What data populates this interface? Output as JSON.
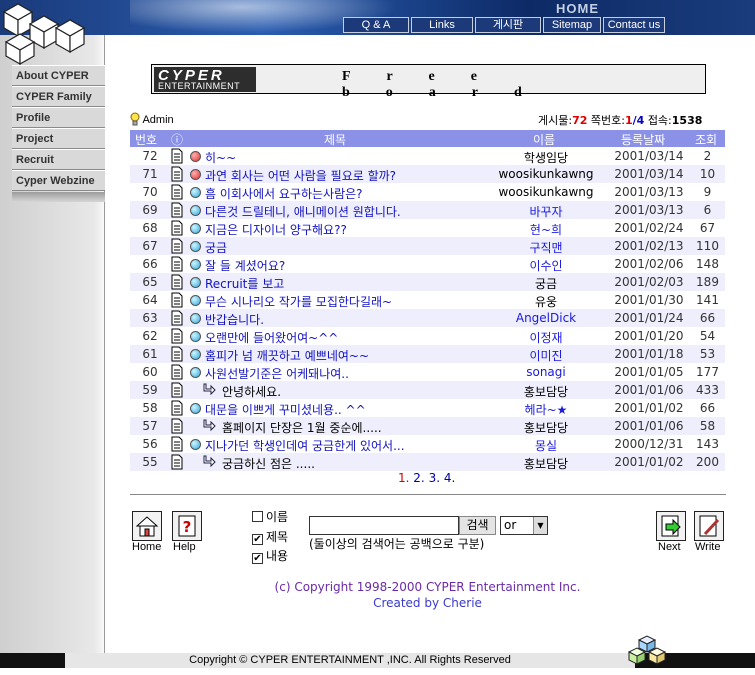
{
  "header": {
    "home_label": "HOME",
    "nav": [
      {
        "label": "Q & A"
      },
      {
        "label": "Links"
      },
      {
        "label": "게시판"
      },
      {
        "label": "Sitemap"
      },
      {
        "label": "Contact us"
      }
    ]
  },
  "sidebar": {
    "items": [
      {
        "label": "About CYPER"
      },
      {
        "label": "CYPER Family"
      },
      {
        "label": "Profile"
      },
      {
        "label": "Project"
      },
      {
        "label": "Recruit"
      },
      {
        "label": "Cyper Webzine"
      }
    ]
  },
  "board_title": {
    "logo_big": "CYPER",
    "logo_small": "ENTERTAINMENT",
    "title": "Free board"
  },
  "admin_label": "Admin",
  "stats": {
    "posts_label": "게시물:",
    "posts": "72",
    "page_label": "쪽번호:",
    "page_cur": "1",
    "page_sep": "/",
    "page_total": "4",
    "visits_label": "접속:",
    "visits": "1538"
  },
  "columns": {
    "num": "번호",
    "info_icon": "ⓘ",
    "title": "제목",
    "author": "이름",
    "date": "등록날짜",
    "hits": "조회"
  },
  "rows": [
    {
      "num": "72",
      "dot": "red",
      "reply": false,
      "title": "히~~",
      "author": "학생임당",
      "author_blue": false,
      "date": "2001/03/14",
      "hits": "2"
    },
    {
      "num": "71",
      "dot": "red",
      "reply": false,
      "title": "과연 회사는 어떤 사람을 필요로 할까?",
      "author": "woosikunkawng",
      "author_blue": false,
      "date": "2001/03/14",
      "hits": "10"
    },
    {
      "num": "70",
      "dot": "blue",
      "reply": false,
      "title": "흠 이회사에서 요구하는사람은?",
      "author": "woosikunkawng",
      "author_blue": false,
      "date": "2001/03/13",
      "hits": "9"
    },
    {
      "num": "69",
      "dot": "blue",
      "reply": false,
      "title": "다른것 드릴테니, 애니메이션 원합니다.",
      "author": "바꾸자",
      "author_blue": true,
      "date": "2001/03/13",
      "hits": "6"
    },
    {
      "num": "68",
      "dot": "blue",
      "reply": false,
      "title": "지금은 디자이너 양구해요??",
      "author": "현~희",
      "author_blue": true,
      "date": "2001/02/24",
      "hits": "67"
    },
    {
      "num": "67",
      "dot": "blue",
      "reply": false,
      "title": "궁금",
      "author": "구직맨",
      "author_blue": true,
      "date": "2001/02/13",
      "hits": "110"
    },
    {
      "num": "66",
      "dot": "blue",
      "reply": false,
      "title": "잘 들 계셨어요?",
      "author": "이수인",
      "author_blue": true,
      "date": "2001/02/06",
      "hits": "148"
    },
    {
      "num": "65",
      "dot": "blue",
      "reply": false,
      "title": "Recruit를 보고",
      "author": "궁금",
      "author_blue": false,
      "date": "2001/02/03",
      "hits": "189"
    },
    {
      "num": "64",
      "dot": "blue",
      "reply": false,
      "title": "무슨 시나리오 작가를 모집한다길래~",
      "author": "유웅",
      "author_blue": false,
      "date": "2001/01/30",
      "hits": "141"
    },
    {
      "num": "63",
      "dot": "blue",
      "reply": false,
      "title": "반갑습니다.",
      "author": "AngelDick",
      "author_blue": true,
      "date": "2001/01/24",
      "hits": "66"
    },
    {
      "num": "62",
      "dot": "blue",
      "reply": false,
      "title": "오랜만에 들어왔어여~^^",
      "author": "이정재",
      "author_blue": true,
      "date": "2001/01/20",
      "hits": "54"
    },
    {
      "num": "61",
      "dot": "blue",
      "reply": false,
      "title": "홈피가 넘 깨끗하고 예쁘네여~~",
      "author": "이미진",
      "author_blue": true,
      "date": "2001/01/18",
      "hits": "53"
    },
    {
      "num": "60",
      "dot": "blue",
      "reply": false,
      "title": "사원선발기준은 어케돼나여..",
      "author": "sonagi",
      "author_blue": true,
      "date": "2001/01/05",
      "hits": "177"
    },
    {
      "num": "59",
      "dot": "none",
      "reply": true,
      "title": "안녕하세요.",
      "author": "홍보담당",
      "author_blue": false,
      "date": "2001/01/06",
      "hits": "433"
    },
    {
      "num": "58",
      "dot": "blue",
      "reply": false,
      "title": "대문을 이쁘게 꾸미셨네용.. ^^",
      "author": "헤라~★",
      "author_blue": true,
      "date": "2001/01/02",
      "hits": "66"
    },
    {
      "num": "57",
      "dot": "none",
      "reply": true,
      "title": "홈페이지 단장은 1월 중순에.....",
      "author": "홍보담당",
      "author_blue": false,
      "date": "2001/01/06",
      "hits": "58"
    },
    {
      "num": "56",
      "dot": "blue",
      "reply": false,
      "title": "지나가던 학생인데여 궁금한게 있어서...",
      "author": "몽실",
      "author_blue": true,
      "date": "2000/12/31",
      "hits": "143"
    },
    {
      "num": "55",
      "dot": "none",
      "reply": true,
      "title": "궁금하신 점은 .....",
      "author": "홍보담당",
      "author_blue": false,
      "date": "2001/01/02",
      "hits": "200"
    }
  ],
  "pager": {
    "current": "1.",
    "pages": [
      "2.",
      "3.",
      "4."
    ]
  },
  "tools": {
    "home_label": "Home",
    "help_label": "Help",
    "next_label": "Next",
    "write_label": "Write"
  },
  "search": {
    "options": [
      {
        "label": "이름",
        "checked": false
      },
      {
        "label": "제목",
        "checked": true
      },
      {
        "label": "내용",
        "checked": true
      }
    ],
    "value": "",
    "button_label": "검색",
    "select_value": "or",
    "hint": "(둘이상의 검색어는 공백으로 구분)"
  },
  "credits": {
    "copyright": "(c) Copyright 1998-2000 CYPER Entertainment Inc.",
    "created_by": "Created by Cherie"
  },
  "footer": {
    "text": "Copyright © CYPER ENTERTAINMENT ,INC. All Rights Reserved"
  },
  "colors": {
    "header_bar": "#8b91e6",
    "title_link": "#1212c0",
    "count_red": "#dd0000",
    "sidebar_bg": "#d9d9d9"
  }
}
